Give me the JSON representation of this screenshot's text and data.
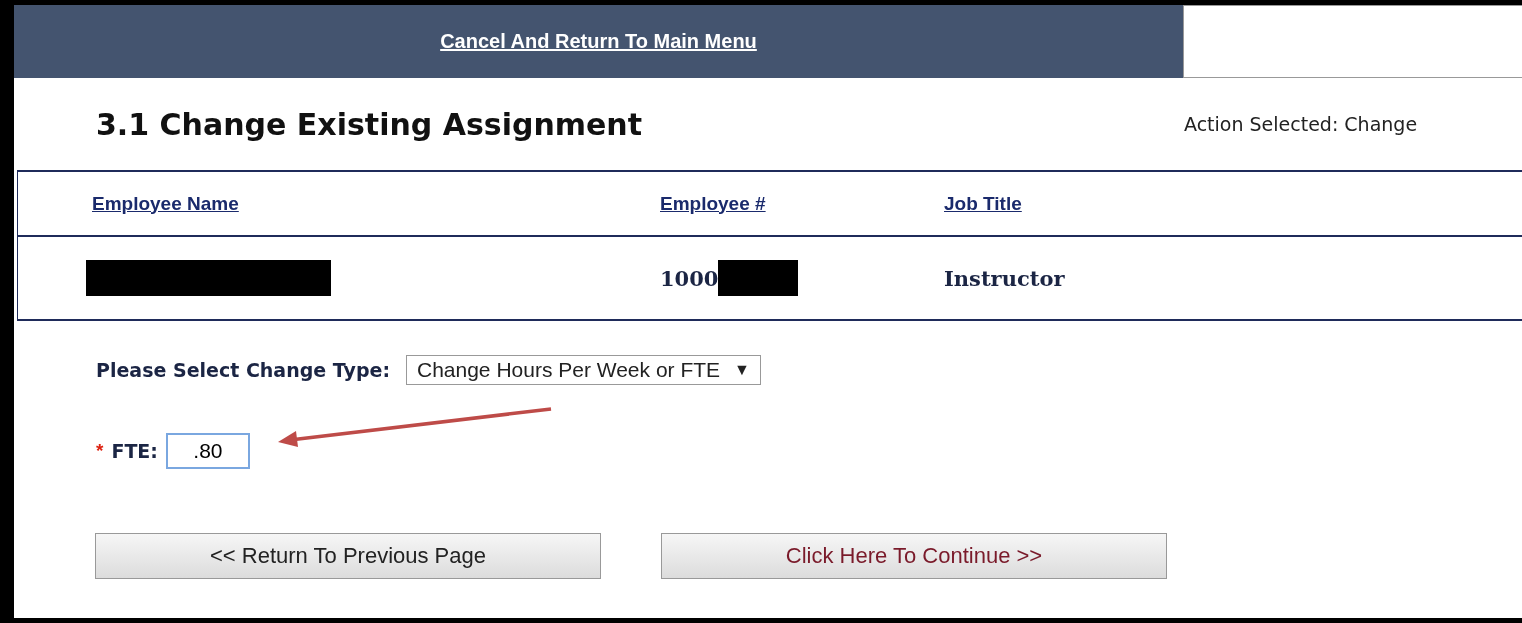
{
  "header": {
    "link": "Cancel And Return To Main Menu"
  },
  "page": {
    "title": "3.1 Change Existing Assignment",
    "action": "Action Selected: Change"
  },
  "table": {
    "columns": [
      "Employee Name",
      "Employee #",
      "Job Title"
    ],
    "row": {
      "employee_name": {
        "redacted": true
      },
      "employee_number": {
        "text": "1000",
        "redacted": true
      },
      "job_title": {
        "text": "Instructor"
      }
    }
  },
  "change_type": {
    "label": "Please Select Change Type:",
    "value": "Change Hours Per Week or FTE",
    "caret": "▼"
  },
  "fte": {
    "required_mark": "*",
    "label": "FTE:",
    "value": ".80",
    "annotated": true
  },
  "buttons": [
    {
      "label": "<< Return To Previous Page",
      "kind": "back"
    },
    {
      "label": "Click Here To Continue >>",
      "kind": "continue"
    }
  ]
}
